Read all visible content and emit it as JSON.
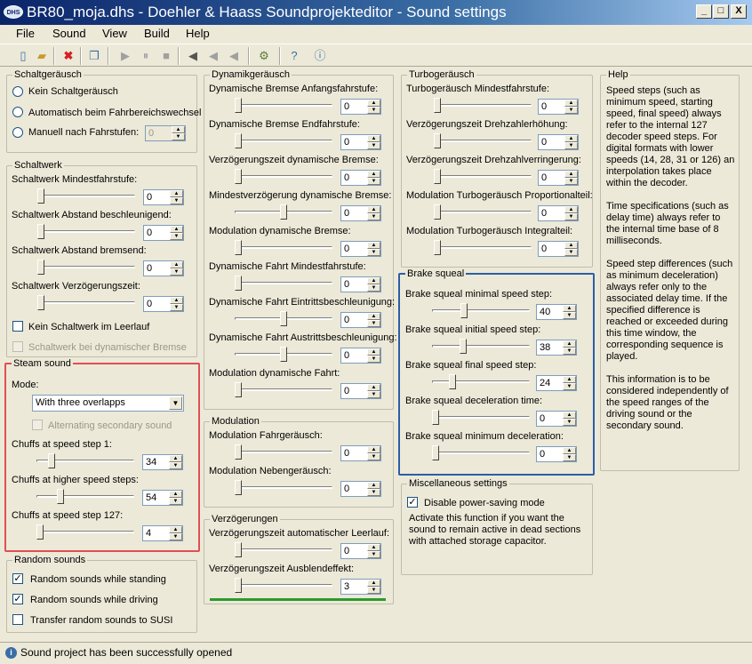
{
  "window": {
    "title": "BR80_moja.dhs - Doehler & Haass Soundprojekteditor - Sound settings",
    "app_badge": "DHS",
    "controls": {
      "minimize": "_",
      "maximize": "□",
      "close": "X"
    }
  },
  "menu": [
    "File",
    "Sound",
    "View",
    "Build",
    "Help"
  ],
  "toolbar": {
    "icons": [
      "new-file-icon",
      "open-folder-icon",
      "delete-icon",
      "copy-icon",
      "play-icon",
      "pause-icon",
      "stop-icon",
      "speaker-on-icon",
      "speaker-mid-icon",
      "speaker-off-icon",
      "build-gear-icon",
      "help-icon",
      "info-icon"
    ]
  },
  "schaltgeraeusch": {
    "title": "Schaltgeräusch",
    "options": [
      "Kein Schaltgeräusch",
      "Automatisch beim Fahrbereichswechsel",
      "Manuell nach Fahrstufen:"
    ],
    "manual_value": "0"
  },
  "schaltwerk": {
    "title": "Schaltwerk",
    "sliders": [
      {
        "label": "Schaltwerk Mindestfahrstufe:",
        "value": "0",
        "thumb_fraction": 0.0
      },
      {
        "label": "Schaltwerk Abstand beschleunigend:",
        "value": "0",
        "thumb_fraction": 0.0
      },
      {
        "label": "Schaltwerk Abstand bremsend:",
        "value": "0",
        "thumb_fraction": 0.0
      },
      {
        "label": "Schaltwerk Verzögerungszeit:",
        "value": "0",
        "thumb_fraction": 0.0
      }
    ],
    "check_idle": "Kein Schaltwerk im Leerlauf",
    "check_brake": "Schaltwerk bei dynamischer Bremse"
  },
  "steam": {
    "title": "Steam sound",
    "mode_label": "Mode:",
    "mode_value": "With three overlapps",
    "alt_label": "Alternating secondary sound",
    "sliders": [
      {
        "label": "Chuffs at speed step 1:",
        "value": "34",
        "thumb_fraction": 0.13
      },
      {
        "label": "Chuffs at higher speed steps:",
        "value": "54",
        "thumb_fraction": 0.23
      },
      {
        "label": "Chuffs at speed step 127:",
        "value": "4",
        "thumb_fraction": 0.0
      }
    ]
  },
  "random": {
    "title": "Random sounds",
    "items": [
      {
        "label": "Random sounds while standing",
        "checked": "✓"
      },
      {
        "label": "Random sounds while driving",
        "checked": "✓"
      },
      {
        "label": "Transfer random sounds to SUSI",
        "checked": ""
      }
    ]
  },
  "dynamik": {
    "title": "Dynamikgeräusch",
    "sliders": [
      {
        "label": "Dynamische Bremse Anfangsfahrstufe:",
        "value": "0",
        "thumb_fraction": 0.0
      },
      {
        "label": "Dynamische Bremse Endfahrstufe:",
        "value": "0",
        "thumb_fraction": 0.0
      },
      {
        "label": "Verzögerungszeit dynamische Bremse:",
        "value": "0",
        "thumb_fraction": 0.0
      },
      {
        "label": "Mindestverzögerung dynamische Bremse:",
        "value": "0",
        "thumb_fraction": 0.5
      },
      {
        "label": "Modulation dynamische Bremse:",
        "value": "0",
        "thumb_fraction": 0.0
      },
      {
        "label": "Dynamische Fahrt Mindestfahrstufe:",
        "value": "0",
        "thumb_fraction": 0.0
      },
      {
        "label": "Dynamische Fahrt Eintrittsbeschleunigung:",
        "value": "0",
        "thumb_fraction": 0.5
      },
      {
        "label": "Dynamische Fahrt Austrittsbeschleunigung:",
        "value": "0",
        "thumb_fraction": 0.5
      },
      {
        "label": "Modulation dynamische Fahrt:",
        "value": "0",
        "thumb_fraction": 0.0
      }
    ]
  },
  "modulation": {
    "title": "Modulation",
    "sliders": [
      {
        "label": "Modulation Fahrgeräusch:",
        "value": "0",
        "thumb_fraction": 0.0
      },
      {
        "label": "Modulation Nebengeräusch:",
        "value": "0",
        "thumb_fraction": 0.0
      }
    ]
  },
  "verzoegerungen": {
    "title": "Verzögerungen",
    "sliders": [
      {
        "label": "Verzögerungszeit automatischer Leerlauf:",
        "value": "0",
        "thumb_fraction": 0.0
      },
      {
        "label": "Verzögerungszeit Ausblendeffekt:",
        "value": "3",
        "thumb_fraction": 0.0
      }
    ]
  },
  "turbo": {
    "title": "Turbogeräusch",
    "sliders": [
      {
        "label": "Turbogeräusch Mindestfahrstufe:",
        "value": "0",
        "thumb_fraction": 0.0
      },
      {
        "label": "Verzögerungszeit Drehzahlerhöhung:",
        "value": "0",
        "thumb_fraction": 0.0
      },
      {
        "label": "Verzögerungszeit Drehzahlverringerung:",
        "value": "0",
        "thumb_fraction": 0.0
      },
      {
        "label": "Modulation Turbogeräusch Proportionalteil:",
        "value": "0",
        "thumb_fraction": 0.0
      },
      {
        "label": "Modulation Turbogeräusch Integralteil:",
        "value": "0",
        "thumb_fraction": 0.0
      }
    ]
  },
  "brake": {
    "title": "Brake squeal",
    "sliders": [
      {
        "label": "Brake squeal minimal speed step:",
        "value": "40",
        "thumb_fraction": 0.31
      },
      {
        "label": "Brake squeal initial speed step:",
        "value": "38",
        "thumb_fraction": 0.3
      },
      {
        "label": "Brake squeal final speed step:",
        "value": "24",
        "thumb_fraction": 0.19
      },
      {
        "label": "Brake squeal deceleration time:",
        "value": "0",
        "thumb_fraction": 0.0
      },
      {
        "label": "Brake squeal minimum deceleration:",
        "value": "0",
        "thumb_fraction": 0.0
      }
    ]
  },
  "misc": {
    "title": "Miscellaneous settings",
    "check_label": "Disable power-saving mode",
    "checked": "✓",
    "description": "Activate this function if you want the sound to remain active in dead sections with attached storage capacitor."
  },
  "help": {
    "title": "Help",
    "text": "Speed steps (such as minimum speed, starting speed, final speed) always refer to the internal 127 decoder speed steps. For digital formats with lower speeds (14, 28, 31 or 126) an interpolation takes place within the decoder.\n\nTime specifications (such as delay time) always refer to the internal time base of 8 milliseconds.\n\nSpeed step differences (such as minimum deceleration) always refer only to the associated delay time. If the specified difference is reached or exceeded during this time window, the corresponding sequence is played.\n\nThis information is to be considered independently of the speed ranges of the driving sound or the secondary sound."
  },
  "status": {
    "text": "Sound project has been successfully opened",
    "icon": "i"
  }
}
